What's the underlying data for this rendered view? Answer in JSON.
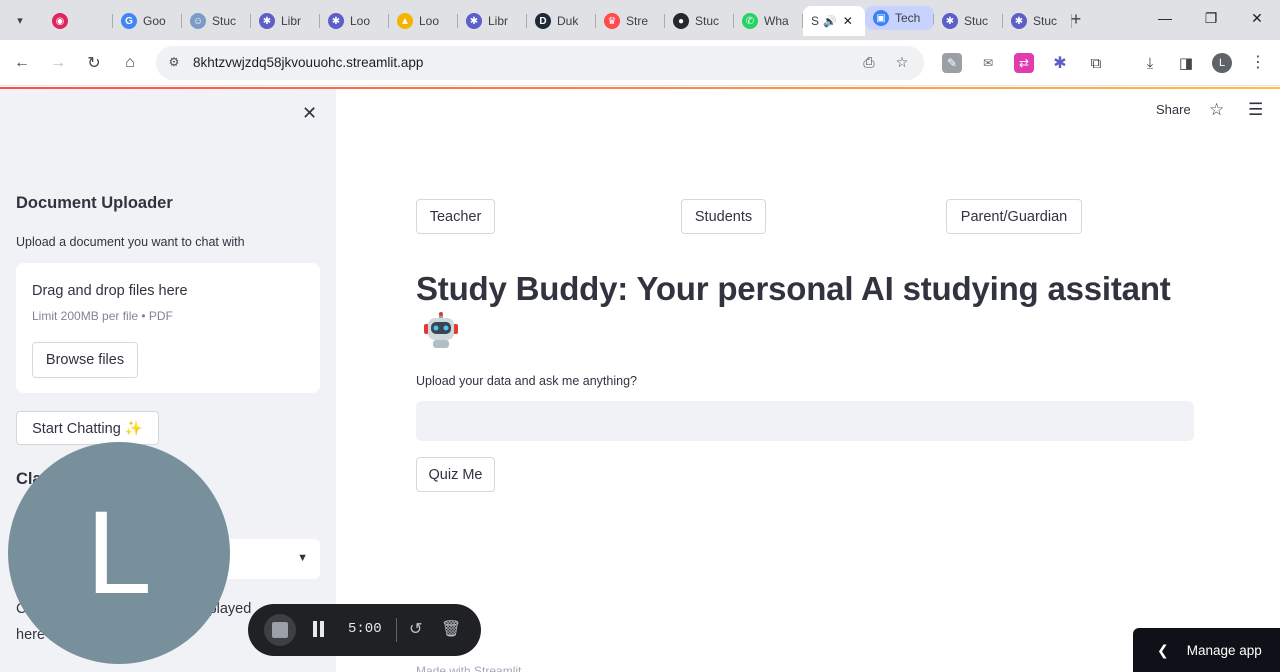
{
  "browser": {
    "tab_list_icon": "chevron-down-icon",
    "tabs": [
      {
        "title": "",
        "icon": "record-icon",
        "color": "#e0245e",
        "glyph": "◉"
      },
      {
        "title": "Goo",
        "icon": "google-icon",
        "color": "#4285f4",
        "glyph": "G"
      },
      {
        "title": "Stuc",
        "icon": "robot-icon",
        "color": "#7c9cc5",
        "glyph": "☺"
      },
      {
        "title": "Libr",
        "icon": "gear-icon",
        "color": "#5b5fc7",
        "glyph": "✱"
      },
      {
        "title": "Loo",
        "icon": "gear-icon",
        "color": "#5b5fc7",
        "glyph": "✱"
      },
      {
        "title": "Loo",
        "icon": "drive-icon",
        "color": "#f4b400",
        "glyph": "▲"
      },
      {
        "title": "Libr",
        "icon": "gear-icon",
        "color": "#5b5fc7",
        "glyph": "✱"
      },
      {
        "title": "Duk",
        "icon": "d-icon",
        "color": "#1e293b",
        "glyph": "D"
      },
      {
        "title": "Stre",
        "icon": "crown-icon",
        "color": "#ff4b4b",
        "glyph": "♛"
      },
      {
        "title": "Stuc",
        "icon": "github-icon",
        "color": "#24292f",
        "glyph": "●"
      },
      {
        "title": "Wha",
        "icon": "whatsapp-icon",
        "color": "#25d366",
        "glyph": "✆"
      },
      {
        "title": "S",
        "icon": "speaker-icon",
        "active": true
      },
      {
        "title": "Tech",
        "icon": "tech-icon",
        "color": "#3b82f6",
        "glyph": "▣",
        "highlight": true
      },
      {
        "title": "Stuc",
        "icon": "gear-icon",
        "color": "#5b5fc7",
        "glyph": "✱"
      },
      {
        "title": "Stuc",
        "icon": "gear-icon",
        "color": "#5b5fc7",
        "glyph": "✱"
      }
    ],
    "url": "8khtzvwjzdq58jkvouuohc.streamlit.app",
    "profile_initial": "L"
  },
  "sidebar": {
    "heading": "Document Uploader",
    "subtitle": "Upload a document you want to chat with",
    "dropzone_title": "Drag and drop files here",
    "dropzone_limit": "Limit 200MB per file • PDF",
    "browse_label": "Browse files",
    "start_label": "Start Chatting ✨",
    "section_label": "Cla",
    "note_line1": "C                                 ll be displayed",
    "note_line2": "here"
  },
  "header": {
    "share_label": "Share"
  },
  "main": {
    "role_buttons": [
      "Teacher",
      "Students",
      "Parent/Guardian"
    ],
    "title": "Study Buddy: Your personal AI studying assitant",
    "upload_label": "Upload your data and ask me anything?",
    "input_placeholder": "",
    "quiz_label": "Quiz Me",
    "footer": "Made with Streamlit"
  },
  "manage_app": {
    "label": "Manage app"
  },
  "recorder": {
    "avatar_initial": "L",
    "timer": "5:00"
  }
}
